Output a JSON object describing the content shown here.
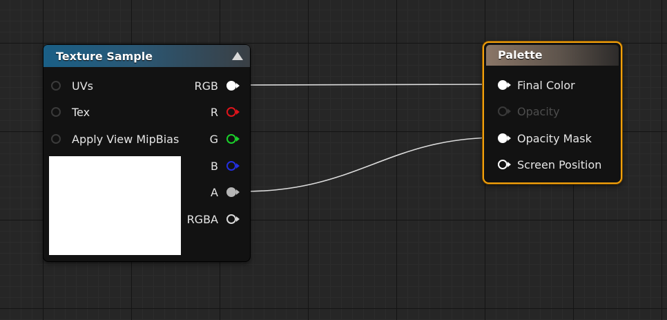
{
  "texture_sample": {
    "title": "Texture Sample",
    "inputs": [
      {
        "label": "UVs"
      },
      {
        "label": "Tex"
      },
      {
        "label": "Apply View MipBias"
      }
    ],
    "outputs": [
      {
        "label": "RGB",
        "color": "#ffffff",
        "connected": true
      },
      {
        "label": "R",
        "color": "#e0141b",
        "connected": false
      },
      {
        "label": "G",
        "color": "#1bd12b",
        "connected": false
      },
      {
        "label": "B",
        "color": "#2430e0",
        "connected": false
      },
      {
        "label": "A",
        "color": "#b5b5b5",
        "connected": true
      },
      {
        "label": "RGBA",
        "color": "#d9d9d9",
        "connected": false
      }
    ],
    "preview_color": "#ffffff"
  },
  "palette": {
    "title": "Palette",
    "inputs": [
      {
        "label": "Final Color",
        "enabled": true,
        "connected": true
      },
      {
        "label": "Opacity",
        "enabled": false,
        "connected": false
      },
      {
        "label": "Opacity Mask",
        "enabled": true,
        "connected": true
      },
      {
        "label": "Screen Position",
        "enabled": true,
        "connected": false
      }
    ]
  },
  "colors": {
    "selection_outline": "#f3a10c",
    "texture_header": "#1a5f86",
    "palette_header": "#8a7667",
    "wire": "#dcdcdc"
  }
}
